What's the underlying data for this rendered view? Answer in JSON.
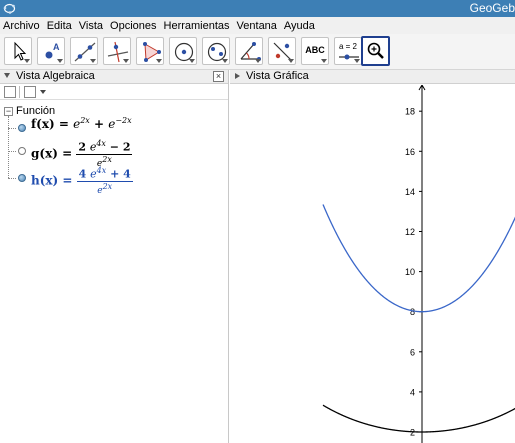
{
  "window": {
    "title": "GeoGeb"
  },
  "menu": {
    "items": [
      "Archivo",
      "Edita",
      "Vista",
      "Opciones",
      "Herramientas",
      "Ventana",
      "Ayuda"
    ]
  },
  "toolbar": {
    "text_tool_label": "ABC",
    "slider_tool_label": "a = 2"
  },
  "algebra_view": {
    "title": "Vista Algebraica",
    "close_label": "×",
    "category": "Función",
    "functions": [
      {
        "name": "f(x)",
        "visible": true,
        "color": "#000000"
      },
      {
        "name": "g(x)",
        "visible": false,
        "color": "#000000"
      },
      {
        "name": "h(x)",
        "visible": true,
        "color": "#1f4cae"
      }
    ]
  },
  "graphics_view": {
    "title": "Vista Gráfica",
    "y_ticks": [
      "2",
      "4",
      "6",
      "8",
      "10",
      "12",
      "14",
      "16",
      "18"
    ]
  },
  "chart_data": {
    "type": "line",
    "x_range": [
      -0.55,
      0.55
    ],
    "ylim": [
      1.5,
      19.5
    ],
    "y_ticks": [
      2,
      4,
      6,
      8,
      10,
      12,
      14,
      16,
      18
    ],
    "grid": false,
    "series": [
      {
        "name": "f",
        "formula": "e^(2x) + e^(-2x)",
        "color": "#000000",
        "min": [
          0,
          2
        ]
      },
      {
        "name": "h",
        "formula": "(4 e^(4x) + 4) / e^(2x)",
        "color": "#3a67c9",
        "min": [
          0,
          8
        ]
      }
    ]
  }
}
